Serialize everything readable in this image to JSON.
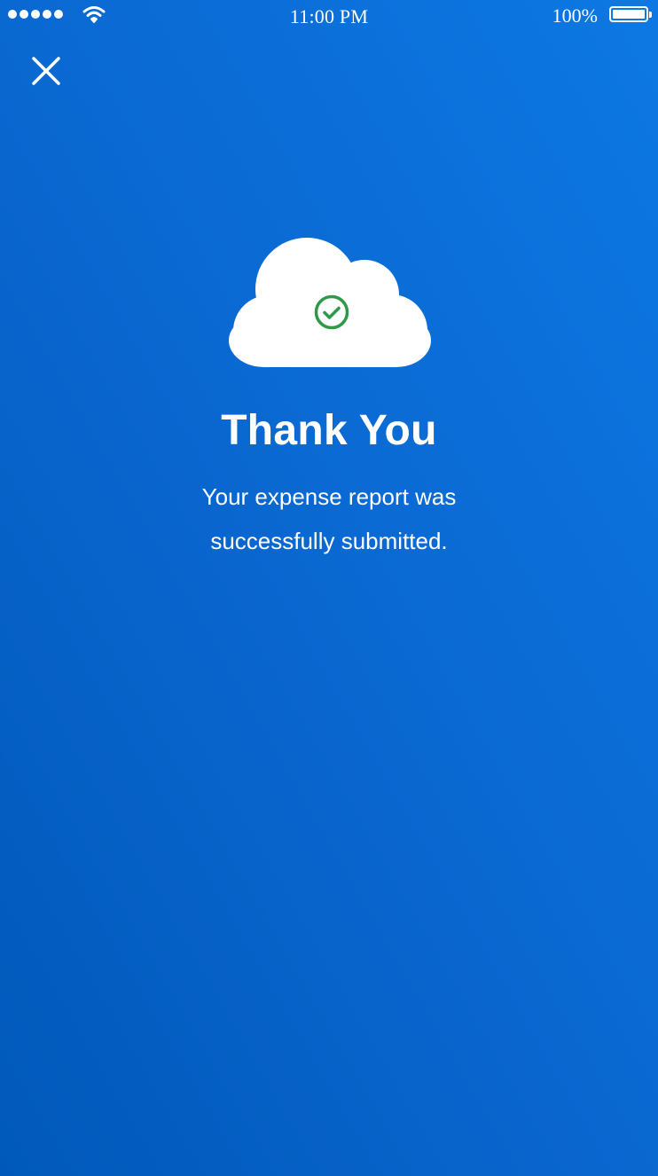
{
  "status_bar": {
    "time": "11:00 PM",
    "battery_percent": "100%",
    "signal_bars": 5,
    "wifi_icon": "wifi-icon",
    "battery_icon": "battery-full-icon"
  },
  "header": {
    "close_icon": "close-icon"
  },
  "illustration": {
    "cloud_icon": "cloud-icon",
    "check_icon": "check-circle-icon",
    "check_color": "#2e9a47"
  },
  "content": {
    "title": "Thank You",
    "message_line1": "Your expense report was",
    "message_line2": "successfully submitted."
  },
  "colors": {
    "background_start": "#0059ba",
    "background_end": "#0d78e3",
    "foreground": "#ffffff"
  }
}
